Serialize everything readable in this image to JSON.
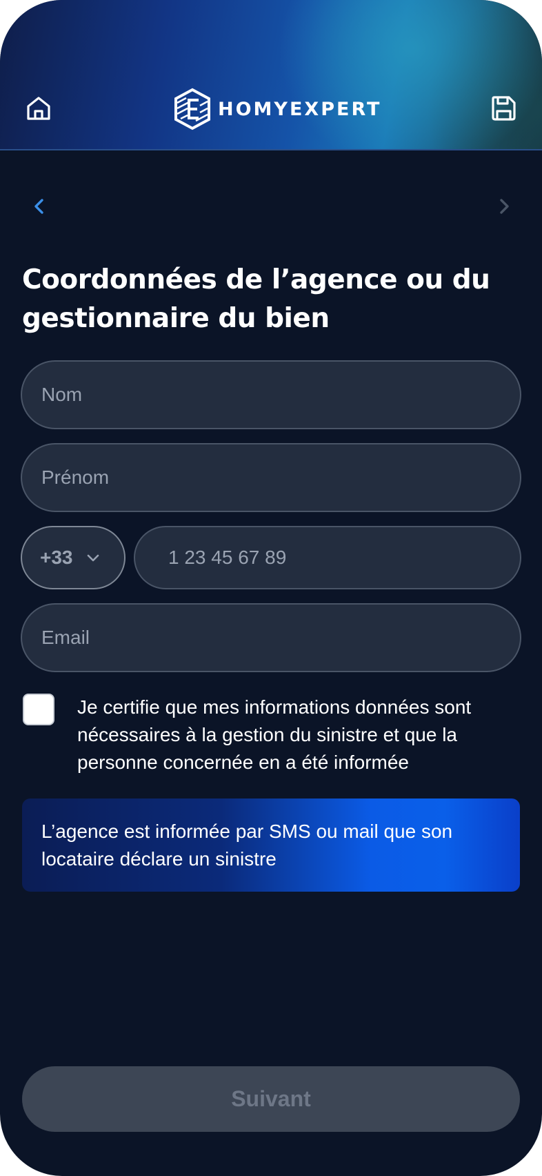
{
  "header": {
    "brand": "HOMYEXPERT",
    "home_icon": "home-icon",
    "save_icon": "save-icon"
  },
  "nav": {
    "prev_icon": "chevron-left-icon",
    "next_icon": "chevron-right-icon"
  },
  "page": {
    "title": "Coordonnées de l’agence ou du gestionnaire du bien"
  },
  "form": {
    "nom_placeholder": "Nom",
    "prenom_placeholder": "Prénom",
    "country_code": "+33",
    "phone_placeholder": "1 23 45 67 89",
    "email_placeholder": "Email",
    "consent_checked": false,
    "consent_text": "Je certifie que mes informations données sont nécessaires à la gestion du sinistre et que la personne concernée en a été informée"
  },
  "info": {
    "text": "L’agence est informée par SMS ou mail que son locataire déclare un sinistre"
  },
  "footer": {
    "next_label": "Suivant"
  },
  "colors": {
    "background": "#0b1427",
    "field_bg": "#232d3f",
    "accent_blue": "#0a5fe9",
    "disabled_button": "#3d4655",
    "nav_active": "#3b8fe8",
    "nav_inactive": "#4a5566"
  }
}
